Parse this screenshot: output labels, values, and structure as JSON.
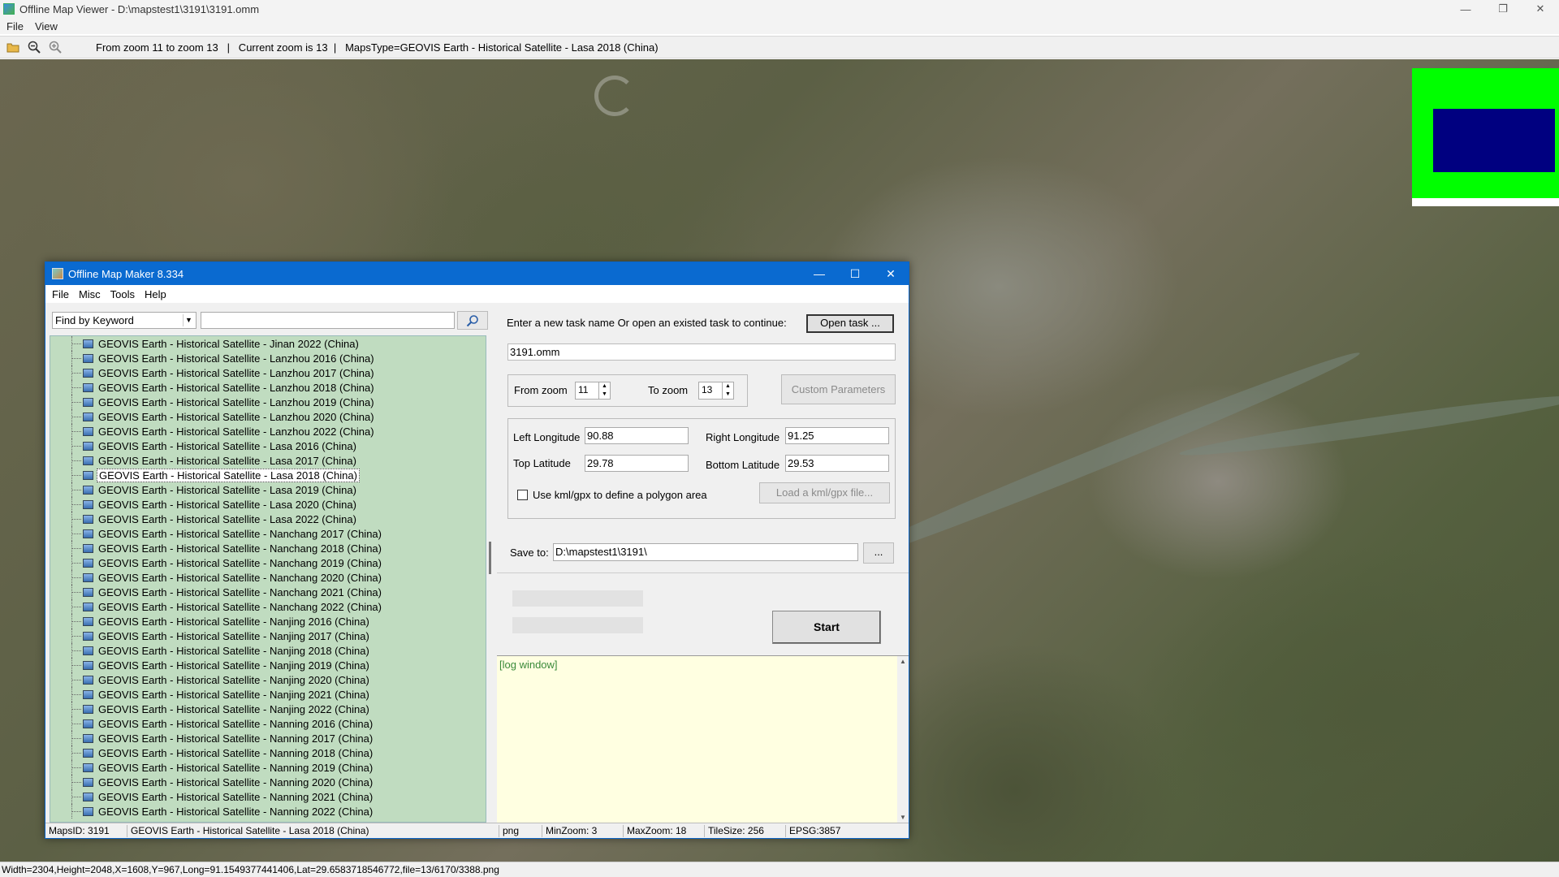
{
  "viewer": {
    "title": "Offline Map Viewer - D:\\mapstest1\\3191\\3191.omm",
    "menu": [
      "File",
      "View"
    ],
    "toolbar_info": "From zoom 11 to zoom 13   |   Current zoom is 13  |   MapsType=GEOVIS Earth - Historical Satellite - Lasa 2018 (China)",
    "status": "Width=2304,Height=2048,X=1608,Y=967,Long=91.1549377441406,Lat=29.6583718546772,file=13/6170/3388.png"
  },
  "dialog": {
    "title": "Offline Map Maker 8.334",
    "menu": [
      "File",
      "Misc",
      "Tools",
      "Help"
    ],
    "search_mode": "Find by Keyword",
    "search_value": "",
    "tree_items": [
      "GEOVIS Earth - Historical Satellite - Jinan 2022 (China)",
      "GEOVIS Earth - Historical Satellite - Lanzhou 2016 (China)",
      "GEOVIS Earth - Historical Satellite - Lanzhou 2017 (China)",
      "GEOVIS Earth - Historical Satellite - Lanzhou 2018 (China)",
      "GEOVIS Earth - Historical Satellite - Lanzhou 2019 (China)",
      "GEOVIS Earth - Historical Satellite - Lanzhou 2020 (China)",
      "GEOVIS Earth - Historical Satellite - Lanzhou 2022 (China)",
      "GEOVIS Earth - Historical Satellite - Lasa 2016 (China)",
      "GEOVIS Earth - Historical Satellite - Lasa 2017 (China)",
      "GEOVIS Earth - Historical Satellite - Lasa 2018 (China)",
      "GEOVIS Earth - Historical Satellite - Lasa 2019 (China)",
      "GEOVIS Earth - Historical Satellite - Lasa 2020 (China)",
      "GEOVIS Earth - Historical Satellite - Lasa 2022 (China)",
      "GEOVIS Earth - Historical Satellite - Nanchang 2017 (China)",
      "GEOVIS Earth - Historical Satellite - Nanchang 2018 (China)",
      "GEOVIS Earth - Historical Satellite - Nanchang 2019 (China)",
      "GEOVIS Earth - Historical Satellite - Nanchang 2020 (China)",
      "GEOVIS Earth - Historical Satellite - Nanchang 2021 (China)",
      "GEOVIS Earth - Historical Satellite - Nanchang 2022 (China)",
      "GEOVIS Earth - Historical Satellite - Nanjing 2016 (China)",
      "GEOVIS Earth - Historical Satellite - Nanjing 2017 (China)",
      "GEOVIS Earth - Historical Satellite - Nanjing 2018 (China)",
      "GEOVIS Earth - Historical Satellite - Nanjing 2019 (China)",
      "GEOVIS Earth - Historical Satellite - Nanjing 2020 (China)",
      "GEOVIS Earth - Historical Satellite - Nanjing 2021 (China)",
      "GEOVIS Earth - Historical Satellite - Nanjing 2022 (China)",
      "GEOVIS Earth - Historical Satellite - Nanning 2016 (China)",
      "GEOVIS Earth - Historical Satellite - Nanning 2017 (China)",
      "GEOVIS Earth - Historical Satellite - Nanning 2018 (China)",
      "GEOVIS Earth - Historical Satellite - Nanning 2019 (China)",
      "GEOVIS Earth - Historical Satellite - Nanning 2020 (China)",
      "GEOVIS Earth - Historical Satellite - Nanning 2021 (China)",
      "GEOVIS Earth - Historical Satellite - Nanning 2022 (China)"
    ],
    "selected_index": 9,
    "task_prompt": "Enter a new task name Or open an existed task to continue:",
    "open_task_label": "Open task ...",
    "task_name": "3191.omm",
    "from_zoom_label": "From zoom",
    "from_zoom": "11",
    "to_zoom_label": "To zoom",
    "to_zoom": "13",
    "custom_params_label": "Custom Parameters",
    "left_lon_label": "Left Longitude",
    "left_lon": "90.88",
    "right_lon_label": "Right Longitude",
    "right_lon": "91.25",
    "top_lat_label": "Top Latitude",
    "top_lat": "29.78",
    "bottom_lat_label": "Bottom Latitude",
    "bottom_lat": "29.53",
    "kml_label": "Use kml/gpx to define a polygon area",
    "kml_checked": false,
    "load_kml_label": "Load a kml/gpx file...",
    "save_to_label": "Save to:",
    "save_to": "D:\\mapstest1\\3191\\",
    "browse_label": "...",
    "start_label": "Start",
    "log_text": "[log window]",
    "status": {
      "maps_id": "MapsID: 3191",
      "maps_name": "GEOVIS Earth - Historical Satellite - Lasa 2018 (China)",
      "format": "png",
      "min_zoom": "MinZoom: 3",
      "max_zoom": "MaxZoom: 18",
      "tile_size": "TileSize: 256",
      "epsg": "EPSG:3857"
    }
  },
  "colors": {
    "tree_bg": "#c0dcc0",
    "titlebar": "#0a6ad0",
    "log_bg": "#ffffe1",
    "overview_green": "#00ff00",
    "overview_blue": "#000080"
  }
}
